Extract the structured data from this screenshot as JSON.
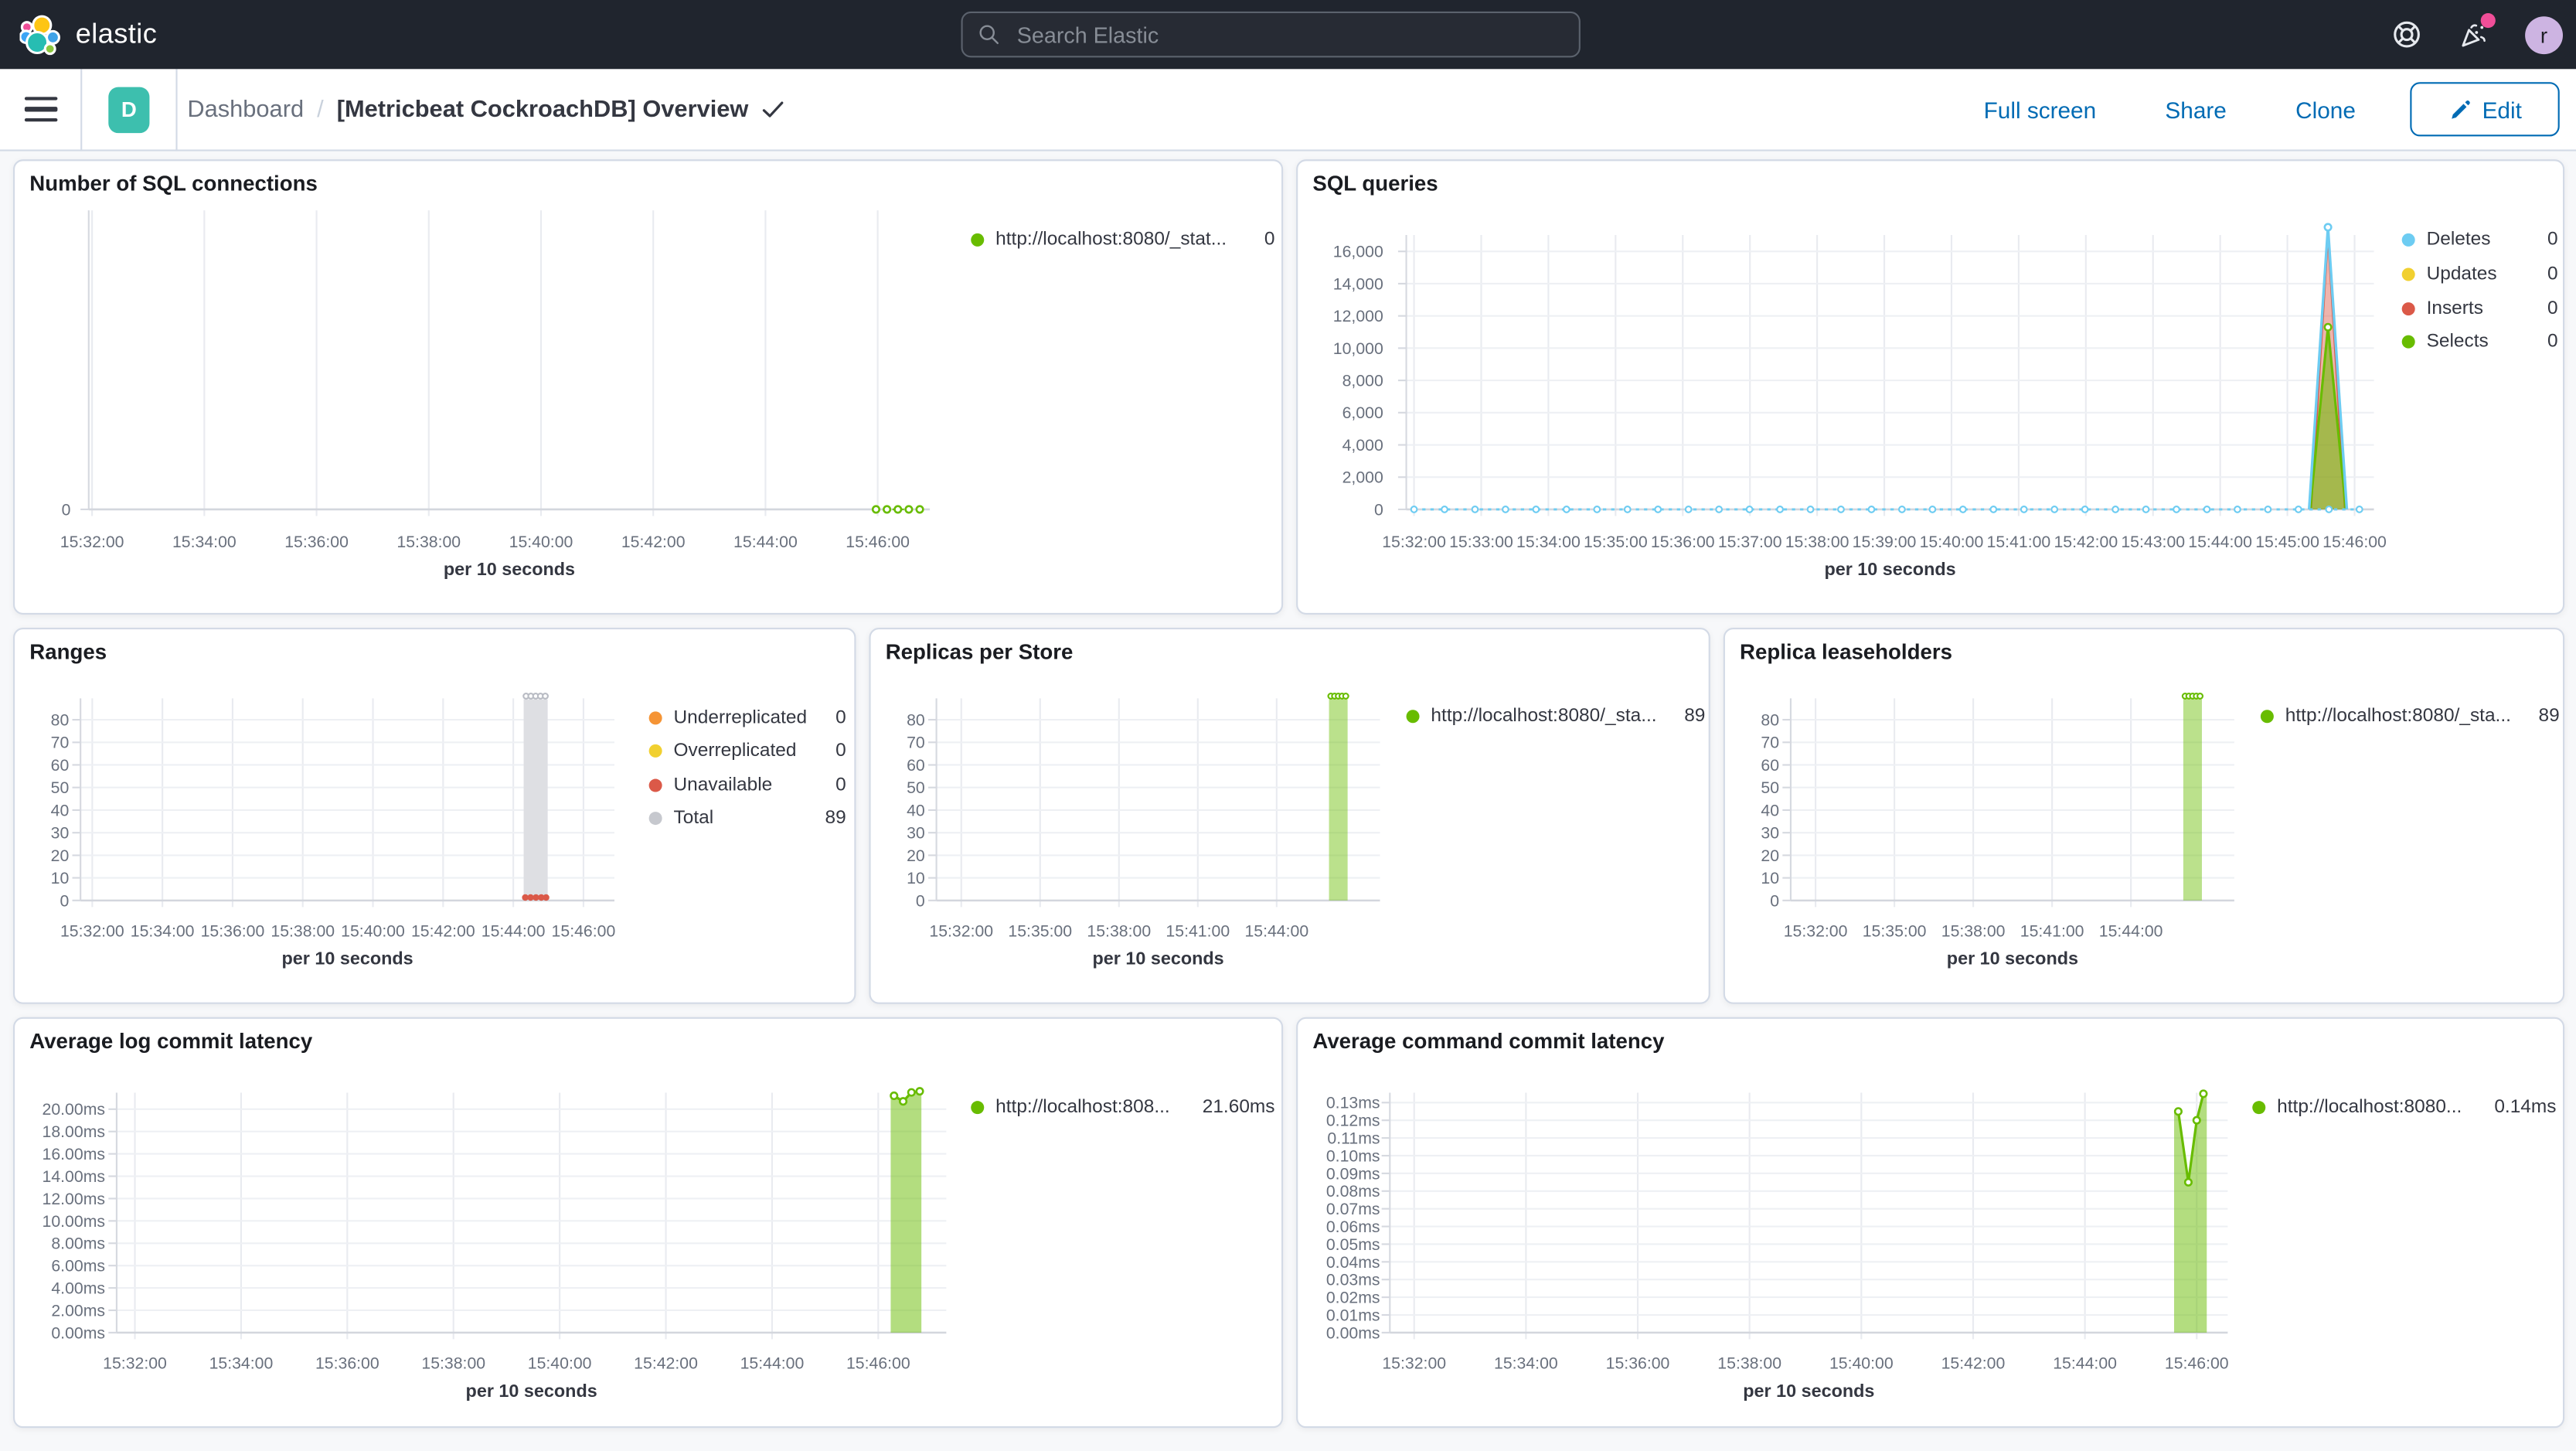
{
  "header": {
    "logo_text": "elastic",
    "search_placeholder": "Search Elastic",
    "avatar_initial": "r",
    "icons": [
      "help-icon",
      "newsfeed-icon"
    ]
  },
  "toolbar": {
    "app_badge": "D",
    "breadcrumb_parent": "Dashboard",
    "breadcrumb_separator": "/",
    "breadcrumb_current": "[Metricbeat CockroachDB] Overview",
    "actions": [
      "Full screen",
      "Share",
      "Clone"
    ],
    "edit_label": "Edit"
  },
  "colors": {
    "accent_blue": "#006bb4",
    "header_bg": "#20252e",
    "app_badge_teal": "#3dbfae",
    "avatar_purple": "#cdb4e2",
    "notification_pink": "#f04e98",
    "series_green": "#68bc00",
    "series_blue": "#6dccf2",
    "series_yellow": "#f1d030",
    "series_red": "#db5948",
    "series_orange": "#f59435",
    "series_gray": "#d9dade"
  },
  "chart_data": [
    {
      "id": "sql-connections",
      "type": "line",
      "title": "Number of SQL connections",
      "xlabel": "per 10 seconds",
      "x_ticks": [
        "15:32:00",
        "15:34:00",
        "15:36:00",
        "15:38:00",
        "15:40:00",
        "15:42:00",
        "15:44:00",
        "15:46:00"
      ],
      "y_ticks": [
        "0"
      ],
      "ylim": [
        0,
        1
      ],
      "legend": [
        {
          "label": "http://localhost:8080/_stat...",
          "value": "0",
          "color": "#68bc00"
        }
      ],
      "series": [
        {
          "name": "http://localhost:8080/_stat...",
          "color": "#68bc00",
          "type": "line",
          "dash": true,
          "width": 1,
          "points": [
            {
              "x": 0.936,
              "v": 0,
              "m": 1
            },
            {
              "x": 0.949,
              "v": 0,
              "m": 1
            },
            {
              "x": 0.962,
              "v": 0,
              "m": 1
            },
            {
              "x": 0.975,
              "v": 0,
              "m": 1
            },
            {
              "x": 0.988,
              "v": 0,
              "m": 1
            }
          ]
        }
      ]
    },
    {
      "id": "sql-queries",
      "type": "area",
      "title": "SQL queries",
      "xlabel": "per 10 seconds",
      "x_ticks": [
        "15:32:00",
        "15:33:00",
        "15:34:00",
        "15:35:00",
        "15:36:00",
        "15:37:00",
        "15:38:00",
        "15:39:00",
        "15:40:00",
        "15:41:00",
        "15:42:00",
        "15:43:00",
        "15:44:00",
        "15:45:00",
        "15:46:00"
      ],
      "y_ticks": [
        "0",
        "2,000",
        "4,000",
        "6,000",
        "8,000",
        "10,000",
        "12,000",
        "14,000",
        "16,000"
      ],
      "ylim": [
        0,
        16000
      ],
      "legend": [
        {
          "label": "Deletes",
          "value": "0",
          "color": "#6dccf2"
        },
        {
          "label": "Updates",
          "value": "0",
          "color": "#f1d030"
        },
        {
          "label": "Inserts",
          "value": "0",
          "color": "#db5948"
        },
        {
          "label": "Selects",
          "value": "0",
          "color": "#68bc00"
        }
      ],
      "series": [
        {
          "name": "Inserts",
          "color": "#db5948",
          "type": "area",
          "opacity": 0.45,
          "width": 1.2,
          "points": [
            {
              "x": 0.935,
              "v": 0
            },
            {
              "x": 0.9525,
              "v": 17000
            },
            {
              "x": 0.97,
              "v": 0
            }
          ]
        },
        {
          "name": "Selects",
          "color": "#68bc00",
          "type": "area",
          "opacity": 0.55,
          "width": 1.5,
          "points": [
            {
              "x": 0.934,
              "v": 0
            },
            {
              "x": 0.9525,
              "v": 11300,
              "m": 1
            },
            {
              "x": 0.971,
              "v": 0
            }
          ]
        },
        {
          "name": "Deletes",
          "color": "#6dccf2",
          "type": "line",
          "width": 1.6,
          "baseline": {
            "x0": 0.008,
            "x1": 0.985,
            "n": 32,
            "v": 0
          },
          "points": [
            {
              "x": 0.933,
              "v": 0
            },
            {
              "x": 0.9525,
              "v": 17500,
              "m": 1
            },
            {
              "x": 0.972,
              "v": 0
            }
          ]
        }
      ]
    },
    {
      "id": "ranges",
      "type": "bar",
      "title": "Ranges",
      "xlabel": "per 10 seconds",
      "x_ticks": [
        "15:32:00",
        "15:34:00",
        "15:36:00",
        "15:38:00",
        "15:40:00",
        "15:42:00",
        "15:44:00",
        "15:46:00"
      ],
      "y_ticks": [
        "0",
        "10",
        "20",
        "30",
        "40",
        "50",
        "60",
        "70",
        "80"
      ],
      "ylim": [
        0,
        80
      ],
      "legend": [
        {
          "label": "Underreplicated",
          "value": "0",
          "color": "#f59435"
        },
        {
          "label": "Overreplicated",
          "value": "0",
          "color": "#f1d030"
        },
        {
          "label": "Unavailable",
          "value": "0",
          "color": "#db5948"
        },
        {
          "label": "Total",
          "value": "89",
          "color": "#c6c8ce"
        }
      ],
      "series": [
        {
          "name": "Total",
          "color": "#dedfe3",
          "opacity": 1,
          "marker_color": "#b9bcc4",
          "bar": {
            "x": 0.83,
            "w": 0.045,
            "v": 89,
            "top_markers": 5
          }
        },
        {
          "name": "Unavailable",
          "color": "#db5948",
          "type": "dots",
          "points": [
            {
              "x": 0.833,
              "v": 1.3
            },
            {
              "x": 0.843,
              "v": 1.3
            },
            {
              "x": 0.853,
              "v": 1.3
            },
            {
              "x": 0.863,
              "v": 1.3
            },
            {
              "x": 0.872,
              "v": 1.3
            }
          ]
        }
      ]
    },
    {
      "id": "replicas-per-store",
      "type": "bar",
      "title": "Replicas per Store",
      "xlabel": "per 10 seconds",
      "x_ticks": [
        "15:32:00",
        "15:35:00",
        "15:38:00",
        "15:41:00",
        "15:44:00"
      ],
      "y_ticks": [
        "0",
        "10",
        "20",
        "30",
        "40",
        "50",
        "60",
        "70",
        "80"
      ],
      "ylim": [
        0,
        80
      ],
      "legend": [
        {
          "label": "http://localhost:8080/_sta...",
          "value": "89",
          "color": "#68bc00"
        }
      ],
      "series": [
        {
          "name": "http://localhost:8080/_sta...",
          "color": "#68bc00",
          "opacity": 0.45,
          "bar": {
            "x": 0.885,
            "w": 0.042,
            "v": 89,
            "top_markers": 5
          }
        }
      ]
    },
    {
      "id": "replica-leaseholders",
      "type": "bar",
      "title": "Replica leaseholders",
      "xlabel": "per 10 seconds",
      "x_ticks": [
        "15:32:00",
        "15:35:00",
        "15:38:00",
        "15:41:00",
        "15:44:00"
      ],
      "y_ticks": [
        "0",
        "10",
        "20",
        "30",
        "40",
        "50",
        "60",
        "70",
        "80"
      ],
      "ylim": [
        0,
        80
      ],
      "legend": [
        {
          "label": "http://localhost:8080/_sta...",
          "value": "89",
          "color": "#68bc00"
        }
      ],
      "series": [
        {
          "name": "http://localhost:8080/_sta...",
          "color": "#68bc00",
          "opacity": 0.45,
          "bar": {
            "x": 0.885,
            "w": 0.042,
            "v": 89,
            "top_markers": 5
          }
        }
      ]
    },
    {
      "id": "avg-log-commit-latency",
      "type": "area",
      "title": "Average log commit latency",
      "xlabel": "per 10 seconds",
      "x_ticks": [
        "15:32:00",
        "15:34:00",
        "15:36:00",
        "15:38:00",
        "15:40:00",
        "15:42:00",
        "15:44:00",
        "15:46:00"
      ],
      "y_ticks": [
        "0.00ms",
        "2.00ms",
        "4.00ms",
        "6.00ms",
        "8.00ms",
        "10.00ms",
        "12.00ms",
        "14.00ms",
        "16.00ms",
        "18.00ms",
        "20.00ms"
      ],
      "ylim": [
        0,
        20
      ],
      "legend": [
        {
          "label": "http://localhost:808...",
          "value": "21.60ms",
          "color": "#68bc00"
        }
      ],
      "series": [
        {
          "name": "http://localhost:808...",
          "color": "#68bc00",
          "type": "area",
          "opacity": 0.5,
          "width": 1.5,
          "points": [
            {
              "x": 0.933,
              "v": 21.2
            },
            {
              "x": 0.937,
              "v": 21.2,
              "m": 1
            },
            {
              "x": 0.948,
              "v": 20.7,
              "m": 1
            },
            {
              "x": 0.958,
              "v": 21.5,
              "m": 1
            },
            {
              "x": 0.968,
              "v": 21.6,
              "m": 1
            },
            {
              "x": 0.97,
              "v": 21.6
            }
          ]
        }
      ]
    },
    {
      "id": "avg-command-commit-latency",
      "type": "area",
      "title": "Average command commit latency",
      "xlabel": "per 10 seconds",
      "x_ticks": [
        "15:32:00",
        "15:34:00",
        "15:36:00",
        "15:38:00",
        "15:40:00",
        "15:42:00",
        "15:44:00",
        "15:46:00"
      ],
      "y_ticks": [
        "0.00ms",
        "0.01ms",
        "0.02ms",
        "0.03ms",
        "0.04ms",
        "0.05ms",
        "0.06ms",
        "0.07ms",
        "0.08ms",
        "0.09ms",
        "0.10ms",
        "0.11ms",
        "0.12ms",
        "0.13ms"
      ],
      "ylim": [
        0,
        0.13
      ],
      "legend": [
        {
          "label": "http://localhost:8080...",
          "value": "0.14ms",
          "color": "#68bc00"
        }
      ],
      "series": [
        {
          "name": "http://localhost:8080...",
          "color": "#68bc00",
          "type": "area",
          "opacity": 0.5,
          "width": 1.5,
          "points": [
            {
              "x": 0.936,
              "v": 0.125
            },
            {
              "x": 0.941,
              "v": 0.125,
              "m": 1
            },
            {
              "x": 0.953,
              "v": 0.085,
              "m": 1
            },
            {
              "x": 0.963,
              "v": 0.12,
              "m": 1
            },
            {
              "x": 0.971,
              "v": 0.135,
              "m": 1
            },
            {
              "x": 0.975,
              "v": 0.135
            }
          ]
        }
      ]
    }
  ]
}
